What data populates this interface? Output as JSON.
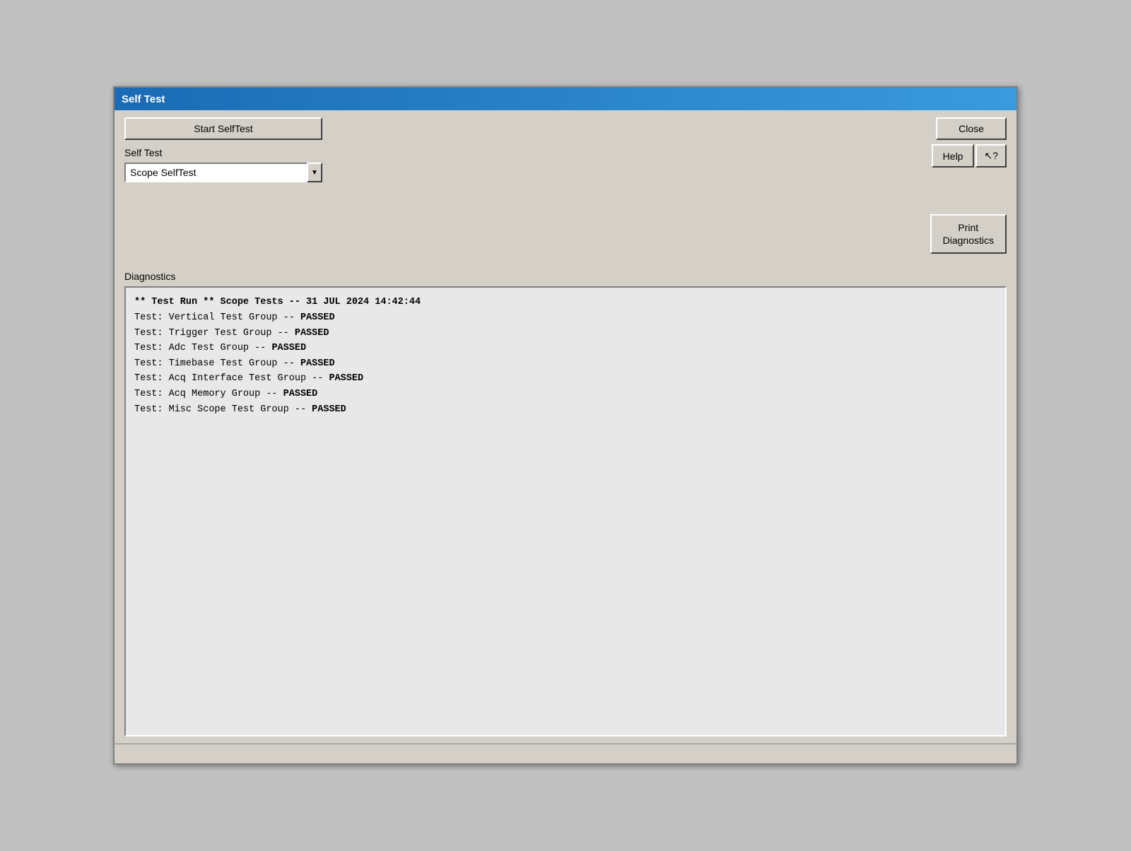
{
  "window": {
    "title": "Self Test"
  },
  "toolbar": {
    "start_selftest_label": "Start SelfTest",
    "close_label": "Close",
    "help_label": "Help",
    "context_help_label": "↖?",
    "print_diagnostics_label": "Print\nDiagnostics"
  },
  "self_test": {
    "label": "Self Test",
    "dropdown": {
      "value": "Scope SelfTest",
      "options": [
        "Scope SelfTest"
      ]
    }
  },
  "diagnostics": {
    "label": "Diagnostics",
    "lines": [
      {
        "type": "header",
        "text": "** Test Run **  Scope Tests -- 31 JUL 2024 14:42:44"
      },
      {
        "type": "result",
        "text": "  Test: Vertical Test Group -- PASSED"
      },
      {
        "type": "result",
        "text": "  Test: Trigger Test Group -- PASSED"
      },
      {
        "type": "result",
        "text": "  Test: Adc Test Group -- PASSED"
      },
      {
        "type": "result",
        "text": "  Test: Timebase Test Group -- PASSED"
      },
      {
        "type": "result",
        "text": "  Test: Acq Interface Test Group -- PASSED"
      },
      {
        "type": "result",
        "text": "  Test: Acq Memory Group -- PASSED"
      },
      {
        "type": "result",
        "text": "  Test: Misc Scope Test Group -- PASSED"
      }
    ]
  }
}
